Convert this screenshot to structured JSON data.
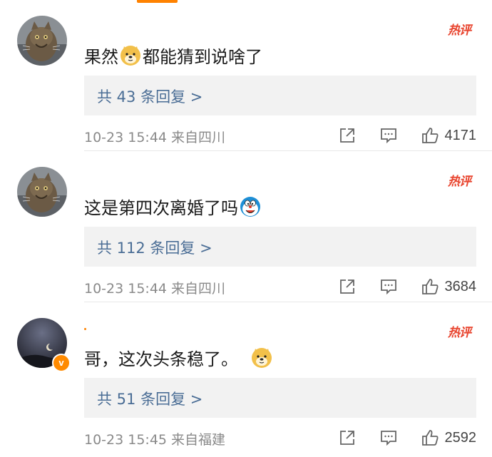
{
  "comments": [
    {
      "badge": "热评",
      "text_before": "果然",
      "text_after": "都能猜到说啥了",
      "emoji": "doge-emoji",
      "reply_label": "共 43 条回复 >",
      "meta": "10-23 15:44  来自四川",
      "likes": "4171"
    },
    {
      "badge": "热评",
      "text_before": "这是第四次离婚了吗",
      "text_after": "",
      "emoji": "doraemon-emoji",
      "reply_label": "共 112 条回复 >",
      "meta": "10-23 15:44  来自四川",
      "likes": "3684"
    },
    {
      "badge": "热评",
      "text_before": "哥，这次头条稳了。",
      "text_after": "",
      "emoji": "doge-emoji",
      "verified_mark": "v",
      "reply_label": "共 51 条回复 >",
      "meta": "10-23 15:45  来自福建",
      "likes": "2592"
    }
  ],
  "colors": {
    "accent": "#ff8200",
    "hot": "#e8442e",
    "link": "#4a6d95",
    "reply_bg": "#f2f2f2"
  }
}
